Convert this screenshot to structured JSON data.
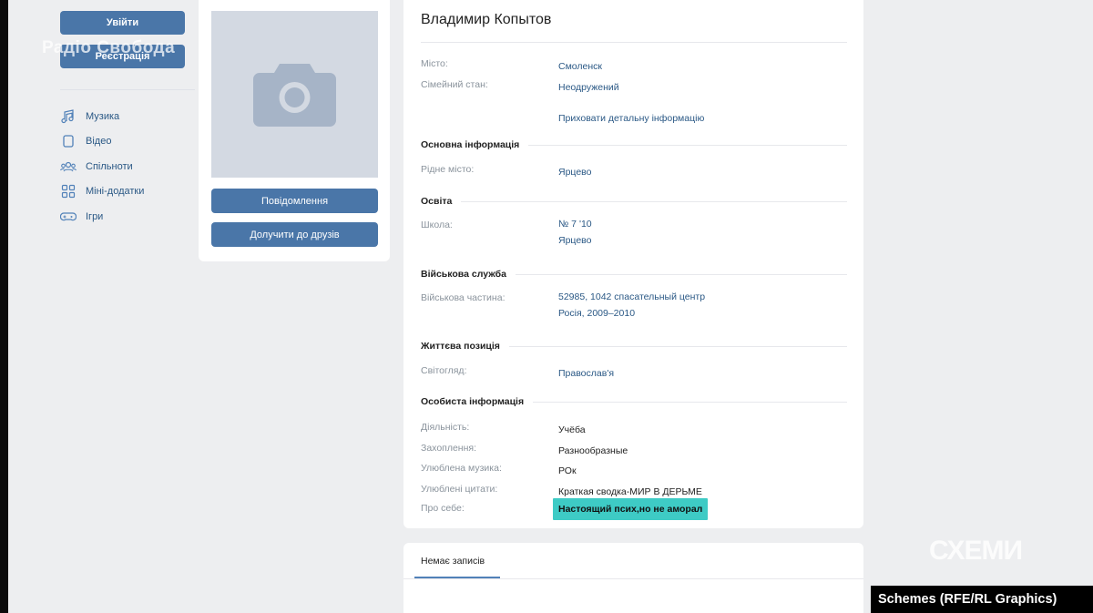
{
  "sidebar": {
    "login_button": "Увійти",
    "register_button": "Реєстрація",
    "watermark": "Радіо Свобода",
    "menu": [
      {
        "icon": "music-note-icon",
        "label": "Музика"
      },
      {
        "icon": "video-icon",
        "label": "Відео"
      },
      {
        "icon": "communities-icon",
        "label": "Спільноти"
      },
      {
        "icon": "apps-grid-icon",
        "label": "Міні-додатки"
      },
      {
        "icon": "gamepad-icon",
        "label": "Ігри"
      }
    ]
  },
  "photo": {
    "placeholder_icon": "camera-icon",
    "message_button": "Повідомлення",
    "add_friend_button": "Долучити до друзів"
  },
  "profile": {
    "name": "Владимир Копытов",
    "city_label": "Місто:",
    "city": "Смоленск",
    "status_label": "Сімейний стан:",
    "status": "Неодружений",
    "hide_details": "Приховати детальну інформацію",
    "sections": {
      "main": "Основна інформація",
      "education": "Освіта",
      "military": "Військова служба",
      "life": "Життєва позиція",
      "personal": "Особиста інформація"
    },
    "hometown_label": "Рідне місто:",
    "hometown": "Ярцево",
    "school_label": "Школа:",
    "school_line1": "№ 7 '10",
    "school_line2": "Ярцево",
    "unit_label": "Військова частина:",
    "unit_line1": "52985, 1042 спасательный центр",
    "unit_line2": "Росія, 2009–2010",
    "worldview_label": "Світогляд:",
    "worldview": "Православ'я",
    "activity_label": "Діяльність:",
    "activity": "Учёба",
    "interests_label": "Захоплення:",
    "interests": "Разнообразные",
    "music_label": "Улюблена музика:",
    "music": "РОк",
    "quotes_label": "Улюблені цитати:",
    "quotes": "Краткая сводка-МИР В ДЕРЬМЕ",
    "about_label": "Про себе:",
    "about": "Настоящий псих,но не аморал"
  },
  "wall": {
    "tab": "Немає записів"
  },
  "overlay": {
    "logo": "СХЕМИ",
    "credit": "Schemes (RFE/RL Graphics)"
  },
  "colors": {
    "vk_blue": "#4a76a8",
    "highlight": "#3ecbc5",
    "background": "#edeef0"
  }
}
